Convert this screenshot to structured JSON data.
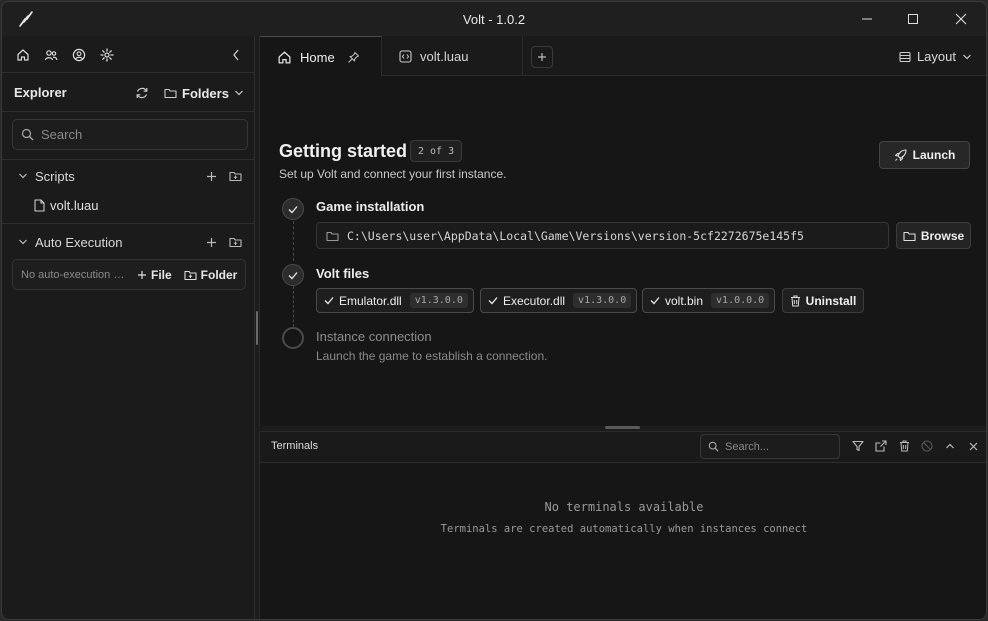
{
  "window": {
    "title": "Volt - 1.0.2"
  },
  "sidebar": {
    "explorer_title": "Explorer",
    "folders_label": "Folders",
    "search_placeholder": "Search",
    "scripts": {
      "label": "Scripts",
      "files": [
        "volt.luau"
      ]
    },
    "auto_execution": {
      "label": "Auto Execution",
      "empty_text": "No auto-execution files",
      "file_label": "File",
      "folder_label": "Folder"
    }
  },
  "tabs": [
    {
      "label": "Home",
      "icon": "home-icon",
      "pinned": true,
      "active": true
    },
    {
      "label": "volt.luau",
      "icon": "code-file-icon",
      "active": false
    }
  ],
  "layout_label": "Layout",
  "getting_started": {
    "title": "Getting started",
    "step_badge": "2 of 3",
    "subtitle": "Set up Volt and connect your first instance.",
    "launch_label": "Launch",
    "steps": [
      {
        "title": "Game installation",
        "status": "done",
        "path": "C:\\Users\\user\\AppData\\Local\\Game\\Versions\\version-5cf2272675e145f5",
        "browse_label": "Browse"
      },
      {
        "title": "Volt files",
        "status": "done",
        "files": [
          {
            "name": "Emulator.dll",
            "version": "v1.3.0.0"
          },
          {
            "name": "Executor.dll",
            "version": "v1.3.0.0"
          },
          {
            "name": "volt.bin",
            "version": "v1.0.0.0"
          }
        ],
        "uninstall_label": "Uninstall"
      },
      {
        "title": "Instance connection",
        "status": "pending",
        "description": "Launch the game to establish a connection."
      }
    ]
  },
  "terminals": {
    "title": "Terminals",
    "search_placeholder": "Search...",
    "empty_title": "No terminals available",
    "empty_subtitle": "Terminals are created automatically when instances connect"
  },
  "colors": {
    "background": "#1c1c1c",
    "panel": "#161616",
    "border": "#2e2e2e",
    "text": "#e6e6e6",
    "muted": "#8a8a8a"
  }
}
